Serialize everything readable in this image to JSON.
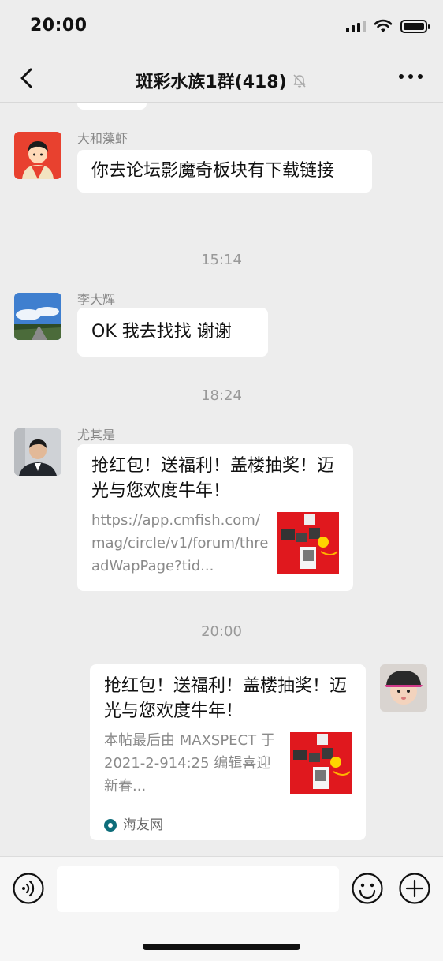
{
  "status_bar": {
    "time": "20:00"
  },
  "nav": {
    "title": "斑彩水族1群(418)"
  },
  "messages": [
    {
      "type": "text",
      "sender": "大和藻虾",
      "text": "你去论坛影魔奇板块有下载链接"
    },
    {
      "type": "time",
      "text": "15:14"
    },
    {
      "type": "text",
      "sender": "李大辉",
      "text": "OK 我去找找 谢谢"
    },
    {
      "type": "time",
      "text": "18:24"
    },
    {
      "type": "link",
      "sender": "尤其是",
      "title": "抢红包！送福利！盖楼抽奖！迈光与您欢度牛年！",
      "desc": "https://app.cmfish.com/mag/circle/v1/forum/threadWapPage?tid..."
    },
    {
      "type": "time",
      "text": "20:00"
    },
    {
      "type": "link",
      "sender": "self",
      "title": "抢红包！送福利！盖楼抽奖！迈光与您欢度牛年！",
      "desc": "本帖最后由 MAXSPECT 于 2021-2-914:25 编辑喜迎新春...",
      "source": "海友网"
    }
  ],
  "colors": {
    "background": "#ededed",
    "bubble": "#ffffff",
    "secondary_text": "#8a8a8a",
    "thumb_red": "#e0181e"
  },
  "icons": [
    "back-icon",
    "mute-icon",
    "more-icon",
    "voice-icon",
    "emoji-icon",
    "plus-icon"
  ]
}
